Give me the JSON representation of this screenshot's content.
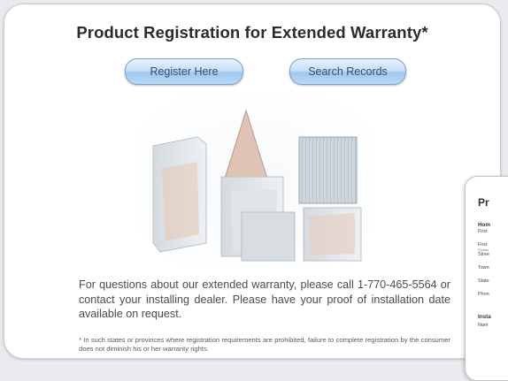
{
  "page": {
    "title": "Product Registration for Extended Warranty*",
    "buttons": {
      "register": "Register Here",
      "search": "Search Records"
    },
    "note": "For questions about our extended warranty, please call 1-770-465-5564 or contact your installing dealer. Please have your proof of installation date available on request.",
    "footnote": "* In such states or provinces where registration requirements are prohibited, failure to complete registration by the consumer does not diminish his or her warranty rights."
  },
  "panel": {
    "title": "Pr",
    "section_home": "Hom",
    "lbl_first": "First",
    "lbl_first2": "First",
    "lbl_optional": "(Optior",
    "lbl_street": "Stree",
    "lbl_town": "Town",
    "lbl_state": "State",
    "lbl_phone": "Phon",
    "section_install": "Insta",
    "lbl_name": "Nam"
  },
  "colors": {
    "button_text": "#2b4f7a",
    "button_border": "#7aa1c9",
    "card_border": "#c9ccd1"
  }
}
